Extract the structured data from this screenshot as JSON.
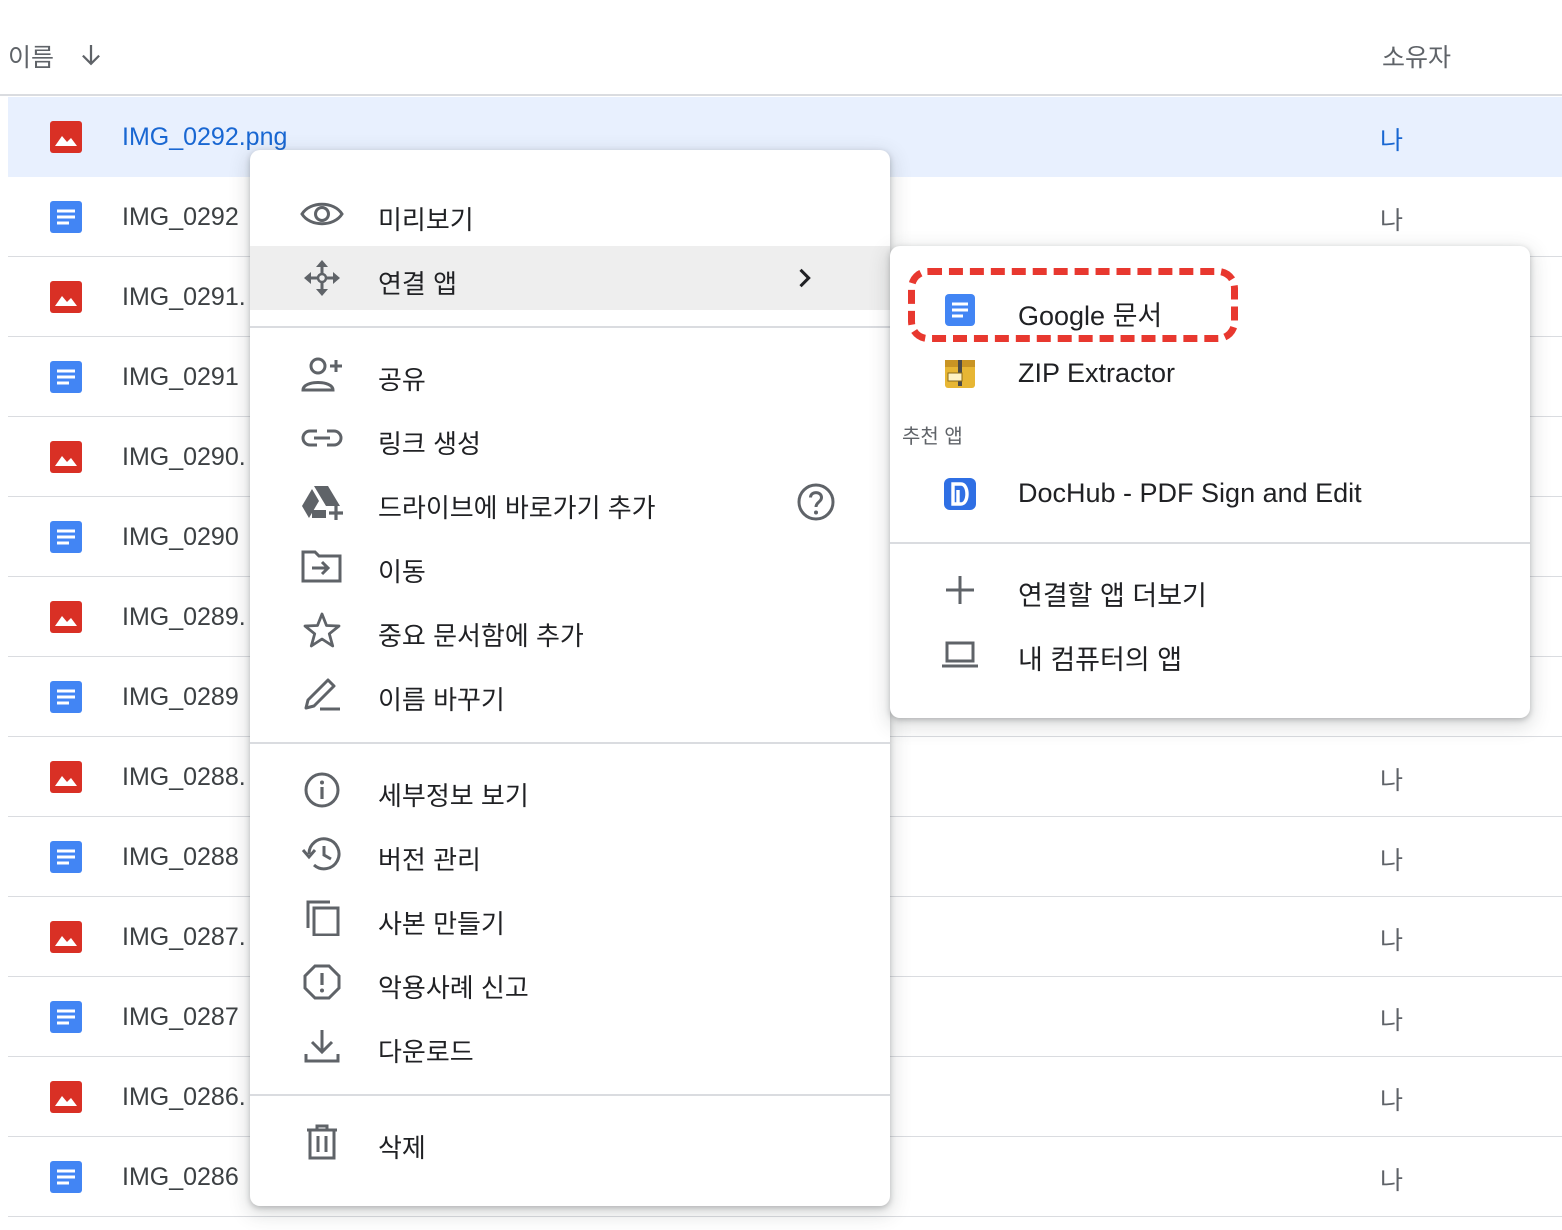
{
  "header": {
    "name_label": "이름",
    "owner_label": "소유자"
  },
  "files": [
    {
      "name": "IMG_0292.png",
      "type": "image",
      "owner": "나",
      "selected": true
    },
    {
      "name": "IMG_0292",
      "type": "doc",
      "owner": "나"
    },
    {
      "name": "IMG_0291.",
      "type": "image",
      "owner": ""
    },
    {
      "name": "IMG_0291",
      "type": "doc",
      "owner": ""
    },
    {
      "name": "IMG_0290.",
      "type": "image",
      "owner": ""
    },
    {
      "name": "IMG_0290",
      "type": "doc",
      "owner": ""
    },
    {
      "name": "IMG_0289.",
      "type": "image",
      "owner": ""
    },
    {
      "name": "IMG_0289",
      "type": "doc",
      "owner": ""
    },
    {
      "name": "IMG_0288.",
      "type": "image",
      "owner": "나"
    },
    {
      "name": "IMG_0288",
      "type": "doc",
      "owner": "나"
    },
    {
      "name": "IMG_0287.",
      "type": "image",
      "owner": "나"
    },
    {
      "name": "IMG_0287",
      "type": "doc",
      "owner": "나"
    },
    {
      "name": "IMG_0286.",
      "type": "image",
      "owner": "나"
    },
    {
      "name": "IMG_0286",
      "type": "doc",
      "owner": "나"
    }
  ],
  "context_menu": {
    "preview": "미리보기",
    "open_with": "연결 앱",
    "share": "공유",
    "get_link": "링크 생성",
    "add_shortcut": "드라이브에 바로가기 추가",
    "move": "이동",
    "add_starred": "중요 문서함에 추가",
    "rename": "이름 바꾸기",
    "details": "세부정보 보기",
    "versions": "버전 관리",
    "copy": "사본 만들기",
    "report": "악용사례 신고",
    "download": "다운로드",
    "delete": "삭제"
  },
  "open_with_menu": {
    "google_docs": "Google 문서",
    "zip_extractor": "ZIP Extractor",
    "suggested_label": "추천 앱",
    "dochub": "DocHub - PDF Sign and Edit",
    "connect_more": "연결할 앱 더보기",
    "computer_apps": "내 컴퓨터의 앱"
  },
  "colors": {
    "image_icon": "#d93025",
    "doc_icon": "#4285f4",
    "selected_row": "#e8f0fe",
    "selected_text": "#1967d2",
    "highlight": "#e8382f"
  }
}
